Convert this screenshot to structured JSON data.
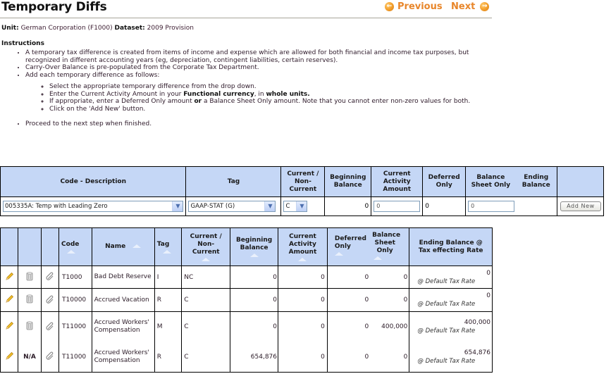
{
  "header": {
    "title": "Temporary Diffs",
    "nav": {
      "previous_label": "Previous",
      "next_label": "Next",
      "previous_icon": "arrow-left-circle",
      "next_icon": "arrow-right-circle",
      "accent_color": "#e8862a"
    },
    "unit_label": "Unit:",
    "unit_value": "German Corporation (F1000)",
    "dataset_label": "Dataset:",
    "dataset_value": "2009 Provision"
  },
  "instructions": {
    "label": "Instructions",
    "bullet1": "A temporary tax difference is created from items of income and expense which are allowed for both financial and income tax purposes, but recognized in different accounting years (eg, depreciation, contingent liabilities, certain reserves).",
    "bullet2": "Carry-Over Balance is pre-populated from the Corporate Tax Department.",
    "bullet3": "Add each temporary difference as follows:",
    "sub1": "Select the appropriate temporary difference from the drop down.",
    "sub2_pre": "Enter the Current Activity Amount in your ",
    "sub2_b1": "Functional currency",
    "sub2_mid": ", in ",
    "sub2_b2": "whole units.",
    "sub3_pre": "If appropriate, enter a Deferred Only amount ",
    "sub3_b": "or",
    "sub3_post": " a Balance Sheet Only amount. Note that you cannot enter non-zero values for both.",
    "sub4": "Click on the 'Add New' button.",
    "bullet4": "Proceed to the next step when finished."
  },
  "add_form": {
    "headers": {
      "code_description": "Code - Description",
      "tag": "Tag",
      "current_noncurrent": "Current / Non-Current",
      "beginning_balance": "Beginning Balance",
      "current_activity": "Current Activity Amount",
      "deferred_only": "Deferred Only",
      "balance_sheet_only": "Balance Sheet Only",
      "ending_balance": "Ending Balance"
    },
    "code_select_value": "005335A: Temp with Leading Zero",
    "tag_select_value": "GAAP-STAT (G)",
    "current_select_value": "C",
    "beginning_balance": "0",
    "current_activity_value": "0",
    "deferred_only": "0",
    "balance_sheet_only_value": "0",
    "add_button_label": "Add New"
  },
  "list": {
    "headers": {
      "code": "Code",
      "name": "Name",
      "tag": "Tag",
      "current_noncurrent": "Current / Non-Current",
      "beginning_balance": "Beginning Balance",
      "current_activity": "Current Activity Amount",
      "deferred_only": "Deferred Only",
      "balance_sheet_only": "Balance Sheet Only",
      "ending_balance": "Ending Balance @ Tax effecting Rate"
    },
    "rows": [
      {
        "delete": "",
        "code": "T1000",
        "name": "Bad Debt Reserve",
        "tag": "I",
        "current": "NC",
        "beginning": "0",
        "activity": "0",
        "deferred": "0",
        "bs_only": "0",
        "ending": "0",
        "rate": "@ Default Tax Rate"
      },
      {
        "delete": "",
        "code": "T10000",
        "name": "Accrued Vacation",
        "tag": "R",
        "current": "C",
        "beginning": "0",
        "activity": "0",
        "deferred": "0",
        "bs_only": "0",
        "ending": "0",
        "rate": "@ Default Tax Rate"
      },
      {
        "delete": "",
        "code": "T11000",
        "name": "Accrued Workers' Compensation",
        "tag": "M",
        "current": "C",
        "beginning": "0",
        "activity": "0",
        "deferred": "0",
        "bs_only": "400,000",
        "ending": "400,000",
        "rate": "@ Default Tax Rate"
      },
      {
        "delete": "N/A",
        "code": "T11000",
        "name": "Accrued Workers' Compensation",
        "tag": "R",
        "current": "C",
        "beginning": "654,876",
        "activity": "0",
        "deferred": "0",
        "bs_only": "0",
        "ending": "654,876",
        "rate": "@ Default Tax Rate"
      }
    ]
  }
}
